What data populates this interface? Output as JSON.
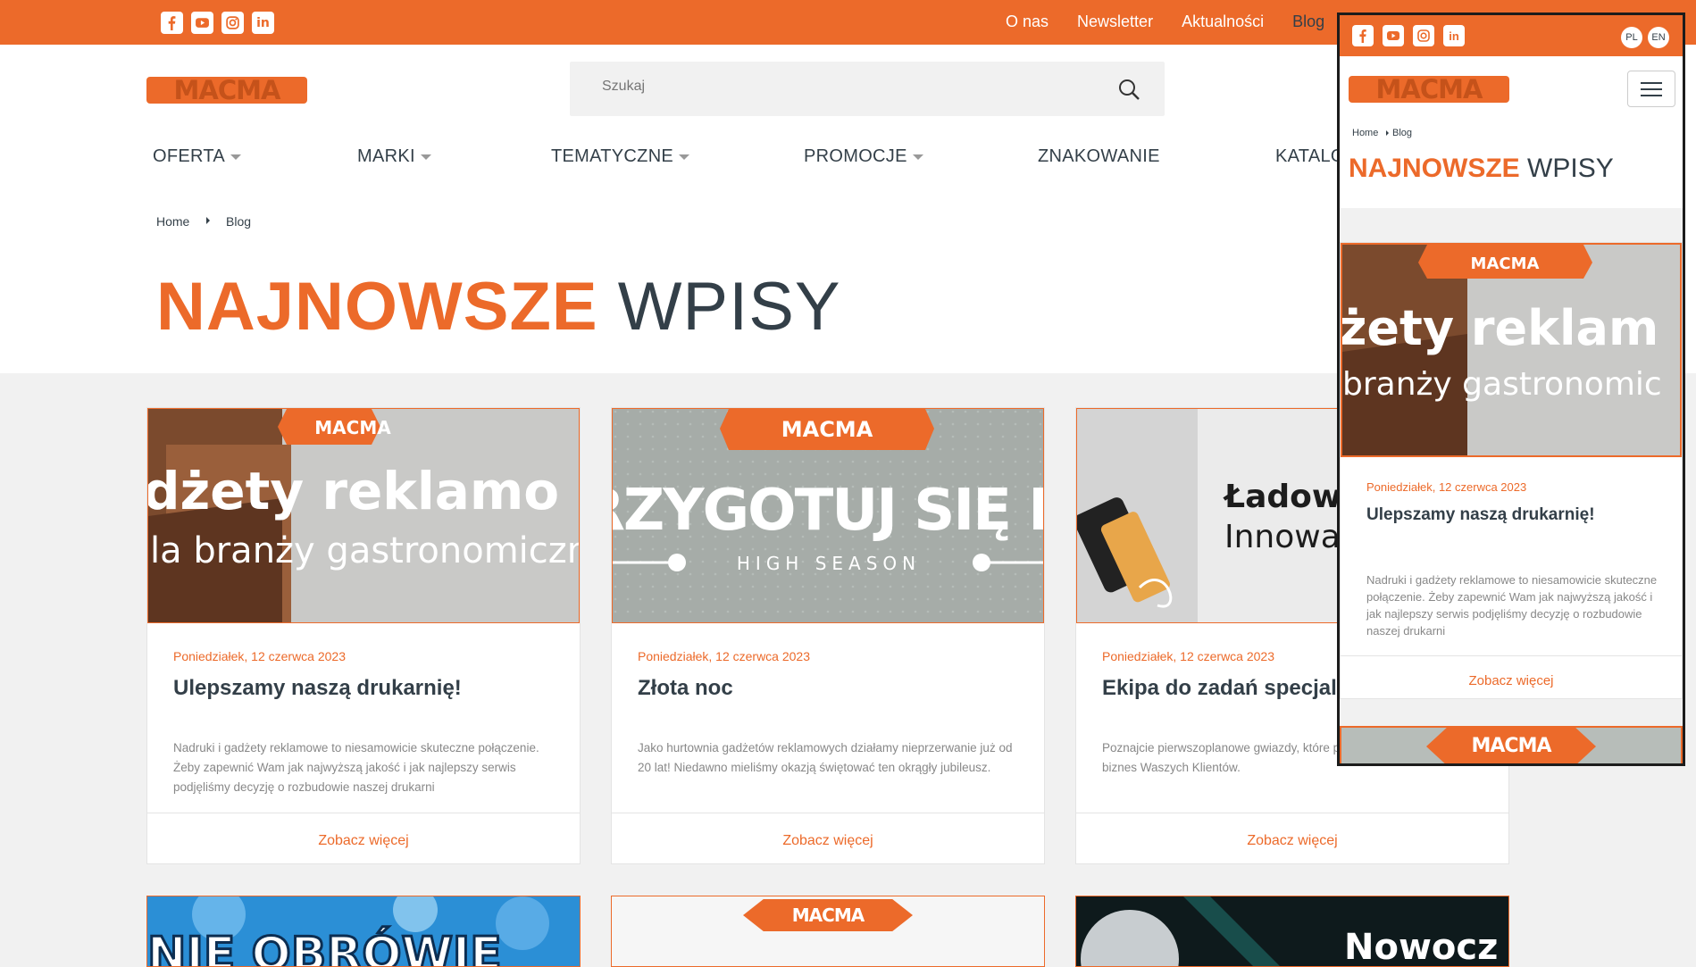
{
  "topbar": {
    "links": [
      "O nas",
      "Newsletter",
      "Aktualności",
      "Blog"
    ],
    "active_link": "Blog",
    "social_icons": [
      "facebook-icon",
      "youtube-icon",
      "instagram-icon",
      "linkedin-icon"
    ]
  },
  "brand": {
    "logo_text": "MACMA",
    "accent": "#ec6a2a",
    "text_dark": "#333f48"
  },
  "search": {
    "placeholder": "Szukaj",
    "value": ""
  },
  "nav": {
    "oferta": "OFERTA",
    "marki": "MARKI",
    "tematyczne": "TEMATYCZNE",
    "promocje": "PROMOCJE",
    "znakowanie": "ZNAKOWANIE",
    "katalogi": "KATALO"
  },
  "breadcrumb": {
    "home": "Home",
    "current": "Blog"
  },
  "heading": {
    "highlight": "NAJNOWSZE",
    "rest": "WPISY"
  },
  "posts": [
    {
      "date": "Poniedziałek, 12 czerwca 2023",
      "title": "Ulepszamy naszą drukarnię!",
      "excerpt": "Nadruki i gadżety reklamowe to niesamowicie skuteczne połączenie. Żeby zapewnić Wam jak najwyższą jakość i jak najlepszy serwis podjęliśmy decyzję o rozbudowie naszej drukarni",
      "more": "Zobacz więcej",
      "image": {
        "line1": "dżety reklamo",
        "line2": "la branży gastronomiczne",
        "badge": "MACMA"
      }
    },
    {
      "date": "Poniedziałek, 12 czerwca 2023",
      "title": "Złota noc",
      "excerpt": "Jako hurtownia gadżetów reklamowych działamy nieprzerwanie już od 20 lat! Niedawno mieliśmy okazją świętować ten okrągły jubileusz.",
      "more": "Zobacz więcej",
      "image": {
        "line1": "PRZYGOTUJ SIĘ NA",
        "line2": "HIGH SEASON",
        "badge": "MACMA"
      }
    },
    {
      "date": "Poniedziałek, 12 czerwca 2023",
      "title": "Ekipa do zadań specjalny",
      "excerpt": "Poznajcie pierwszoplanowe gwiazdy, które pomogą żeby zareklamować biznes Waszych Klientów.",
      "more": "Zobacz więcej",
      "image": {
        "line1": "Ładowa",
        "line2": "Innowa"
      }
    }
  ],
  "next_row": {
    "card1_text": "NIE OBRÓWIE",
    "card2_badge": "MACMA",
    "card3_text": "Nowocz"
  },
  "mobile": {
    "lang_pl": "PL",
    "lang_en": "EN",
    "breadcrumb_home": "Home",
    "breadcrumb_current": "Blog",
    "heading_highlight": "NAJNOWSZE",
    "heading_rest": "WPISY",
    "post": {
      "date": "Poniedziałek, 12 czerwca 2023",
      "title": "Ulepszamy naszą drukarnię!",
      "excerpt": "Nadruki i gadżety reklamowe to niesamowicie skuteczne połączenie. Żeby zapewnić Wam jak najwyższą jakość i jak najlepszy serwis podjęliśmy decyzję o rozbudowie naszej drukarni",
      "more": "Zobacz więcej",
      "image_line1": "żety reklam",
      "image_line2": "branży gastronomic",
      "badge": "MACMA"
    },
    "next_badge": "MACMA"
  }
}
